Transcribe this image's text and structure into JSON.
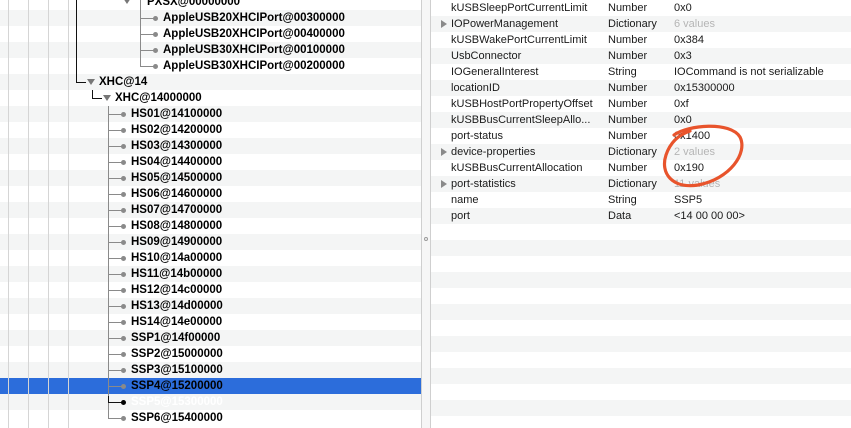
{
  "tree": {
    "pxsx": "PXSX@00000000",
    "hc_ports": [
      "AppleUSB20XHCIPort@00300000",
      "AppleUSB20XHCIPort@00400000",
      "AppleUSB30XHCIPort@00100000",
      "AppleUSB30XHCIPort@00200000"
    ],
    "xhc": "XHC@14",
    "xhc_child": "XHC@14000000",
    "ports": [
      "HS01@14100000",
      "HS02@14200000",
      "HS03@14300000",
      "HS04@14400000",
      "HS05@14500000",
      "HS06@14600000",
      "HS07@14700000",
      "HS08@14800000",
      "HS09@14900000",
      "HS10@14a00000",
      "HS11@14b00000",
      "HS12@14c00000",
      "HS13@14d00000",
      "HS14@14e00000",
      "SSP1@14f00000",
      "SSP2@15000000",
      "SSP3@15100000",
      "SSP4@15200000",
      "SSP5@15300000",
      "SSP6@15400000"
    ],
    "selected": "SSP5@15300000"
  },
  "properties": [
    {
      "key": "kUSBSleepPortCurrentLimit",
      "type": "Number",
      "value": "0x0",
      "expandable": false,
      "dim": false
    },
    {
      "key": "IOPowerManagement",
      "type": "Dictionary",
      "value": "6 values",
      "expandable": true,
      "dim": true
    },
    {
      "key": "kUSBWakePortCurrentLimit",
      "type": "Number",
      "value": "0x384",
      "expandable": false,
      "dim": false
    },
    {
      "key": "UsbConnector",
      "type": "Number",
      "value": "0x3",
      "expandable": false,
      "dim": false
    },
    {
      "key": "IOGeneralInterest",
      "type": "String",
      "value": "IOCommand is not serializable",
      "expandable": false,
      "dim": false
    },
    {
      "key": "locationID",
      "type": "Number",
      "value": "0x15300000",
      "expandable": false,
      "dim": false
    },
    {
      "key": "kUSBHostPortPropertyOffset",
      "type": "Number",
      "value": "0xf",
      "expandable": false,
      "dim": false
    },
    {
      "key": "kUSBBusCurrentSleepAllo...",
      "type": "Number",
      "value": "0x0",
      "expandable": false,
      "dim": false
    },
    {
      "key": "port-status",
      "type": "Number",
      "value": "0x1400",
      "expandable": false,
      "dim": false
    },
    {
      "key": "device-properties",
      "type": "Dictionary",
      "value": "2 values",
      "expandable": true,
      "dim": true
    },
    {
      "key": "kUSBBusCurrentAllocation",
      "type": "Number",
      "value": "0x190",
      "expandable": false,
      "dim": false
    },
    {
      "key": "port-statistics",
      "type": "Dictionary",
      "value": "11 values",
      "expandable": true,
      "dim": true
    },
    {
      "key": "name",
      "type": "String",
      "value": "SSP5",
      "expandable": false,
      "dim": false
    },
    {
      "key": "port",
      "type": "Data",
      "value": "<14 00 00 00>",
      "expandable": false,
      "dim": false
    }
  ],
  "colors": {
    "selection": "#2c6ddb",
    "annotation": "#e8542c"
  }
}
